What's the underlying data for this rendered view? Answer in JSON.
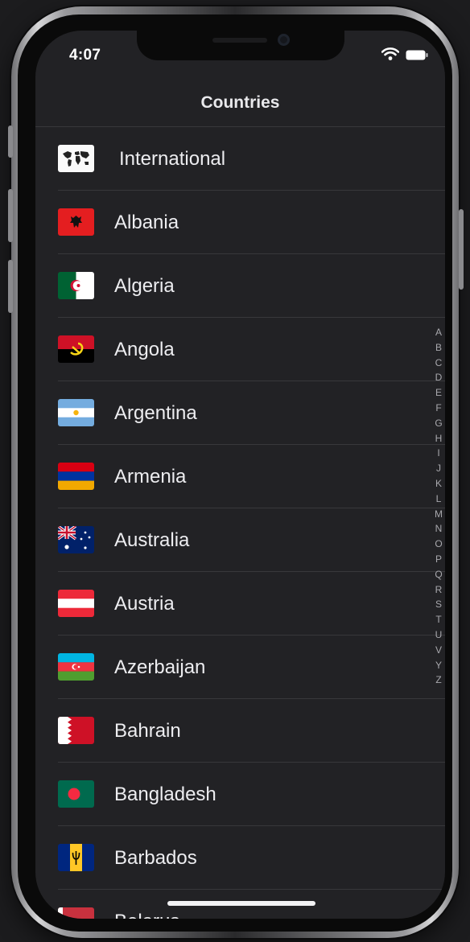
{
  "status": {
    "time": "4:07",
    "wifi_icon": "wifi-icon",
    "battery_icon": "battery-icon"
  },
  "nav": {
    "title": "Countries"
  },
  "countries": [
    {
      "name": "International",
      "flag": "world-map"
    },
    {
      "name": "Albania",
      "flag": "albania"
    },
    {
      "name": "Algeria",
      "flag": "algeria"
    },
    {
      "name": "Angola",
      "flag": "angola"
    },
    {
      "name": "Argentina",
      "flag": "argentina"
    },
    {
      "name": "Armenia",
      "flag": "armenia"
    },
    {
      "name": "Australia",
      "flag": "australia"
    },
    {
      "name": "Austria",
      "flag": "austria"
    },
    {
      "name": "Azerbaijan",
      "flag": "azerbaijan"
    },
    {
      "name": "Bahrain",
      "flag": "bahrain"
    },
    {
      "name": "Bangladesh",
      "flag": "bangladesh"
    },
    {
      "name": "Barbados",
      "flag": "barbados"
    },
    {
      "name": "Belarus",
      "flag": "belarus"
    }
  ],
  "index_letters": [
    "A",
    "B",
    "C",
    "D",
    "E",
    "F",
    "G",
    "H",
    "I",
    "J",
    "K",
    "L",
    "M",
    "N",
    "O",
    "P",
    "Q",
    "R",
    "S",
    "T",
    "U",
    "V",
    "Y",
    "Z"
  ],
  "colors": {
    "background": "#222225",
    "text": "#ededf0",
    "divider": "#38383b",
    "index": "#a8a8ad"
  }
}
